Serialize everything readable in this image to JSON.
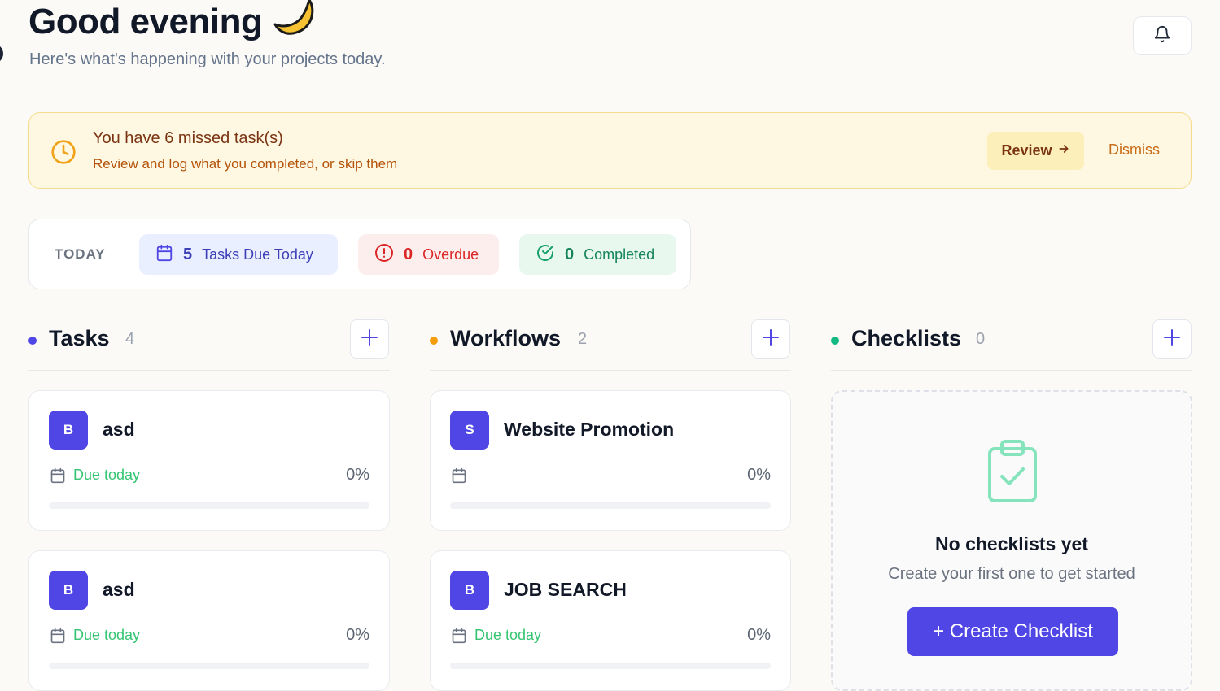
{
  "header": {
    "greeting": "Good evening",
    "subtitle": "Here's what's happening with your projects today."
  },
  "icons": {
    "greeting": "crescent-moon-icon",
    "notifications": "bell-icon",
    "alert": "clock-icon",
    "due": "calendar-icon",
    "overdue": "alert-circle-icon",
    "completed": "check-circle-icon",
    "empty_checklists": "clipboard-check-icon"
  },
  "colors": {
    "accent": "#4f46e5",
    "warning": "#f59e0b",
    "success": "#10b981",
    "danger": "#dc2626"
  },
  "alert": {
    "title": "You have 6 missed task(s)",
    "description": "Review and log what you completed, or skip them",
    "review_label": "Review",
    "dismiss_label": "Dismiss"
  },
  "today": {
    "label": "TODAY",
    "due": {
      "count": "5",
      "label": "Tasks Due Today"
    },
    "overdue": {
      "count": "0",
      "label": "Overdue"
    },
    "completed": {
      "count": "0",
      "label": "Completed"
    }
  },
  "columns": {
    "tasks": {
      "title": "Tasks",
      "count": "4",
      "items": [
        {
          "initial": "B",
          "title": "asd",
          "due": "Due today",
          "percent": "0%",
          "progress": 0
        },
        {
          "initial": "B",
          "title": "asd",
          "due": "Due today",
          "percent": "0%",
          "progress": 0
        }
      ]
    },
    "workflows": {
      "title": "Workflows",
      "count": "2",
      "items": [
        {
          "initial": "S",
          "title": "Website Promotion",
          "due": "",
          "percent": "0%",
          "progress": 0
        },
        {
          "initial": "B",
          "title": "JOB SEARCH",
          "due": "Due today",
          "percent": "0%",
          "progress": 0
        }
      ]
    },
    "checklists": {
      "title": "Checklists",
      "count": "0",
      "empty_title": "No checklists yet",
      "empty_description": "Create your first one to get started",
      "create_label": "+ Create Checklist"
    }
  }
}
